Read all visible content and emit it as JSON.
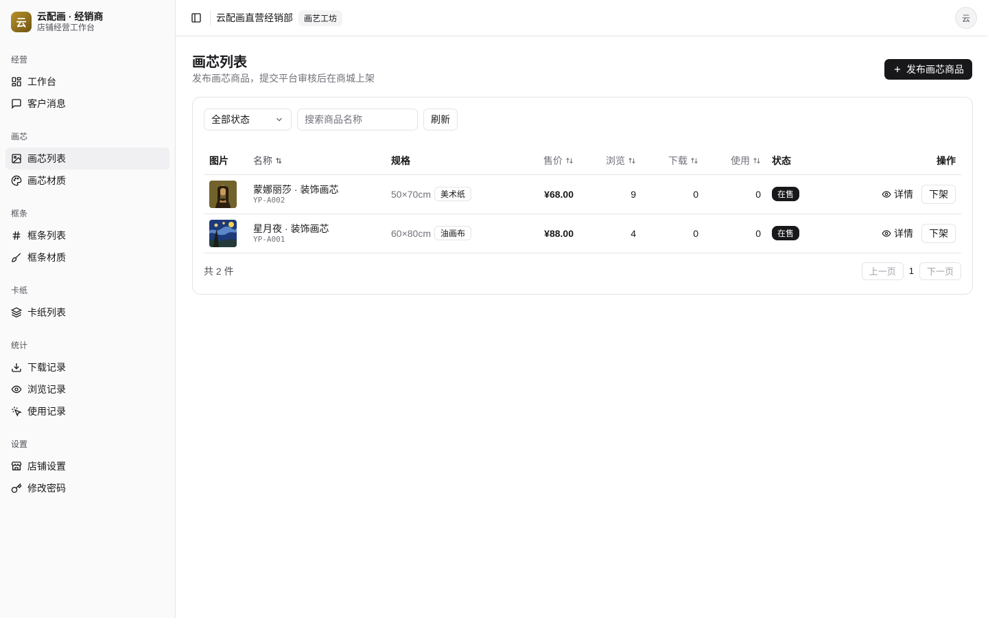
{
  "brand": {
    "logo_char": "云",
    "title": "云配画 · 经销商",
    "subtitle": "店铺经营工作台"
  },
  "sidebar": {
    "groups": [
      {
        "label": "经营",
        "items": [
          {
            "label": "工作台",
            "icon": "dashboard-icon"
          },
          {
            "label": "客户消息",
            "icon": "message-icon"
          }
        ]
      },
      {
        "label": "画芯",
        "items": [
          {
            "label": "画芯列表",
            "icon": "image-icon",
            "active": true
          },
          {
            "label": "画芯材质",
            "icon": "palette-icon"
          }
        ]
      },
      {
        "label": "框条",
        "items": [
          {
            "label": "框条列表",
            "icon": "hash-icon"
          },
          {
            "label": "框条材质",
            "icon": "brush-icon"
          }
        ]
      },
      {
        "label": "卡纸",
        "items": [
          {
            "label": "卡纸列表",
            "icon": "layers-icon"
          }
        ]
      },
      {
        "label": "统计",
        "items": [
          {
            "label": "下载记录",
            "icon": "download-icon"
          },
          {
            "label": "浏览记录",
            "icon": "eye-icon"
          },
          {
            "label": "使用记录",
            "icon": "pointer-icon"
          }
        ]
      },
      {
        "label": "设置",
        "items": [
          {
            "label": "店铺设置",
            "icon": "store-icon"
          },
          {
            "label": "修改密码",
            "icon": "key-icon"
          }
        ]
      }
    ]
  },
  "topbar": {
    "shop_name": "云配画直营经销部",
    "shop_badge": "画艺工坊",
    "avatar": "云"
  },
  "page": {
    "title": "画芯列表",
    "description": "发布画芯商品，提交平台审核后在商城上架",
    "publish_button": "发布画芯商品"
  },
  "filters": {
    "status_selected": "全部状态",
    "search_placeholder": "搜索商品名称",
    "refresh_label": "刷新"
  },
  "table": {
    "headers": {
      "image": "图片",
      "name": "名称",
      "spec": "规格",
      "price": "售价",
      "views": "浏览",
      "downloads": "下载",
      "uses": "使用",
      "status": "状态",
      "actions": "操作"
    },
    "rows": [
      {
        "name": "蒙娜丽莎 · 装饰画芯",
        "code": "YP-A002",
        "size": "50×70cm",
        "material": "美术纸",
        "price": "¥68.00",
        "views": "9",
        "downloads": "0",
        "uses": "0",
        "status": "在售",
        "detail": "详情",
        "unlist": "下架"
      },
      {
        "name": "星月夜 · 装饰画芯",
        "code": "YP-A001",
        "size": "60×80cm",
        "material": "油画布",
        "price": "¥88.00",
        "views": "4",
        "downloads": "0",
        "uses": "0",
        "status": "在售",
        "detail": "详情",
        "unlist": "下架"
      }
    ]
  },
  "pagination": {
    "total": "共 2 件",
    "prev": "上一页",
    "page": "1",
    "next": "下一页"
  }
}
